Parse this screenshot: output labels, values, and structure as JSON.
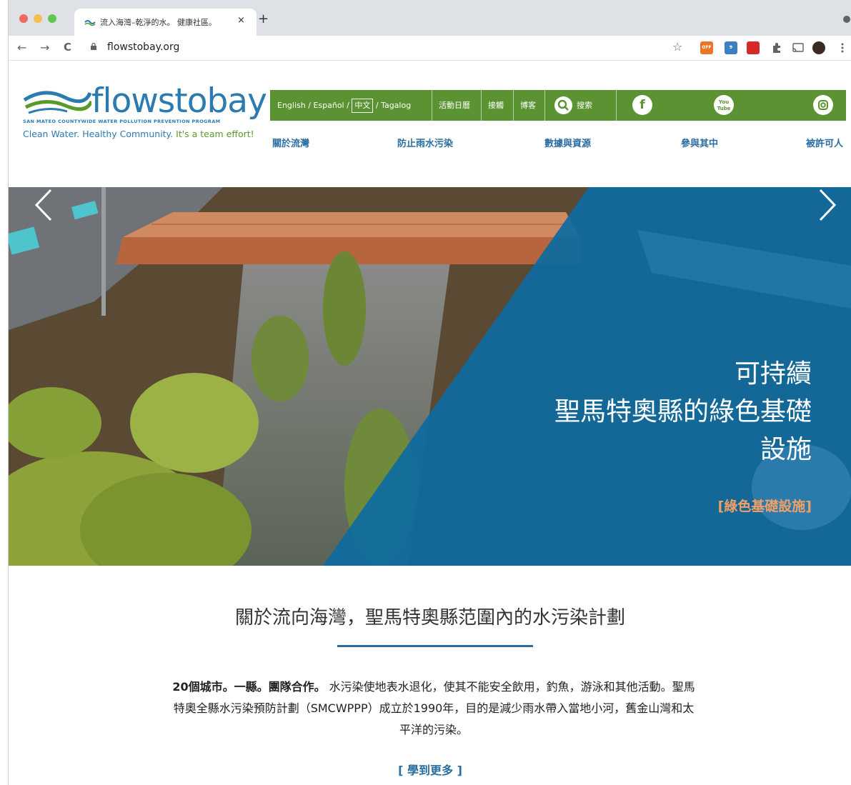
{
  "browser": {
    "tab_title": "流入海灣–乾淨的水。 健康社區。",
    "tab_close": "×",
    "new_tab": "+",
    "url": "flowstobay.org",
    "nav": {
      "back": "←",
      "forward": "→",
      "reload": "C"
    },
    "star": "☆",
    "extension_labels": [
      "OFF",
      "9"
    ]
  },
  "logo": {
    "word": "flowstobay",
    "subtitle": "SAN MATEO COUNTYWIDE WATER POLLUTION PREVENTION PROGRAM",
    "tagline_part1": "Clean Water. Healthy Community.",
    "tagline_part2": " It's a team effort!"
  },
  "topbar": {
    "lang_en": "English",
    "sep1": "/",
    "lang_es": "Español",
    "sep2": "/",
    "lang_zh": "中文",
    "sep3": "/",
    "lang_tl": "Tagalog",
    "calendar": "活動日曆",
    "contact": "接觸",
    "blog": "博客",
    "search": "搜索",
    "social": {
      "facebook": "f",
      "youtube_top": "You",
      "youtube_bottom": "Tube"
    }
  },
  "mainnav": [
    "關於流灣",
    "防止雨水污染",
    "數據與資源",
    "參與其中",
    "被許可人"
  ],
  "hero": {
    "line1": "可持續",
    "line2": "聖馬特奧縣的綠色基礎",
    "line3": "設施",
    "link": "[綠色基礎設施]",
    "prev": "‹",
    "next": "›"
  },
  "about": {
    "title": "關於流向海灣，聖馬特奧縣范圍內的水污染計劃",
    "lead_bold": "20個城市。一縣。團隊合作。",
    "body": " 水污染使地表水退化，使其不能安全飲用，釣魚，游泳和其他活動。聖馬特奧全縣水污染預防計劃（SMCWPPP）成立於1990年，目的是減少雨水帶入當地小河，舊金山灣和太平洋的污染。",
    "learn_more": "[ 學到更多 ]"
  },
  "colors": {
    "green_bar": "#5b9332",
    "brand_blue": "#2b7bb1",
    "nav_blue": "#2b6da1",
    "hero_overlay": "#0e6aa0",
    "link_orange": "#f0a066"
  }
}
